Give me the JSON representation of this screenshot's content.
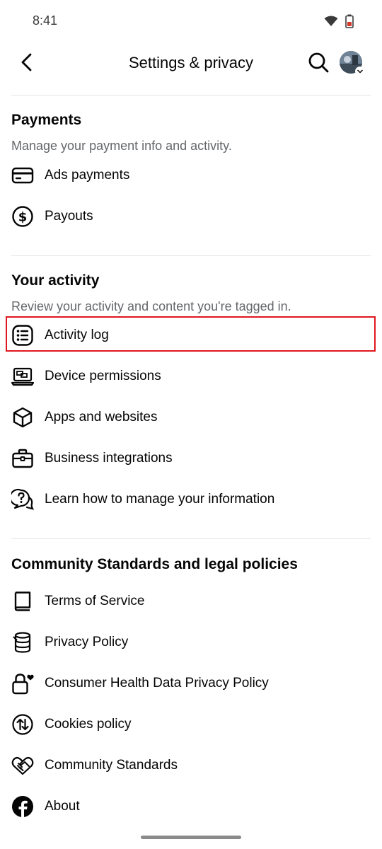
{
  "status_bar": {
    "time": "8:41"
  },
  "header": {
    "title": "Settings & privacy"
  },
  "payments": {
    "title": "Payments",
    "subtitle": "Manage your payment info and activity.",
    "items": [
      {
        "label": "Ads payments",
        "icon": "credit-card-icon"
      },
      {
        "label": "Payouts",
        "icon": "dollar-circle-icon"
      }
    ]
  },
  "activity": {
    "title": "Your activity",
    "subtitle": "Review your activity and content you're tagged in.",
    "items": [
      {
        "label": "Activity log",
        "icon": "list-icon"
      },
      {
        "label": "Device permissions",
        "icon": "laptop-icon"
      },
      {
        "label": "Apps and websites",
        "icon": "cube-icon"
      },
      {
        "label": "Business integrations",
        "icon": "briefcase-icon"
      },
      {
        "label": "Learn how to manage your information",
        "icon": "question-chat-icon"
      }
    ]
  },
  "community": {
    "title": "Community Standards and legal policies",
    "items": [
      {
        "label": "Terms of Service",
        "icon": "book-icon"
      },
      {
        "label": "Privacy Policy",
        "icon": "database-icon"
      },
      {
        "label": "Consumer Health Data Privacy Policy",
        "icon": "lock-heart-icon"
      },
      {
        "label": "Cookies policy",
        "icon": "cookie-arrows-icon"
      },
      {
        "label": "Community Standards",
        "icon": "handshake-heart-icon"
      },
      {
        "label": "About",
        "icon": "facebook-icon"
      }
    ]
  },
  "colors": {
    "highlight": "#e0161e",
    "text": "#050505",
    "secondary_text": "#65676b",
    "divider": "#e4e6eb"
  }
}
